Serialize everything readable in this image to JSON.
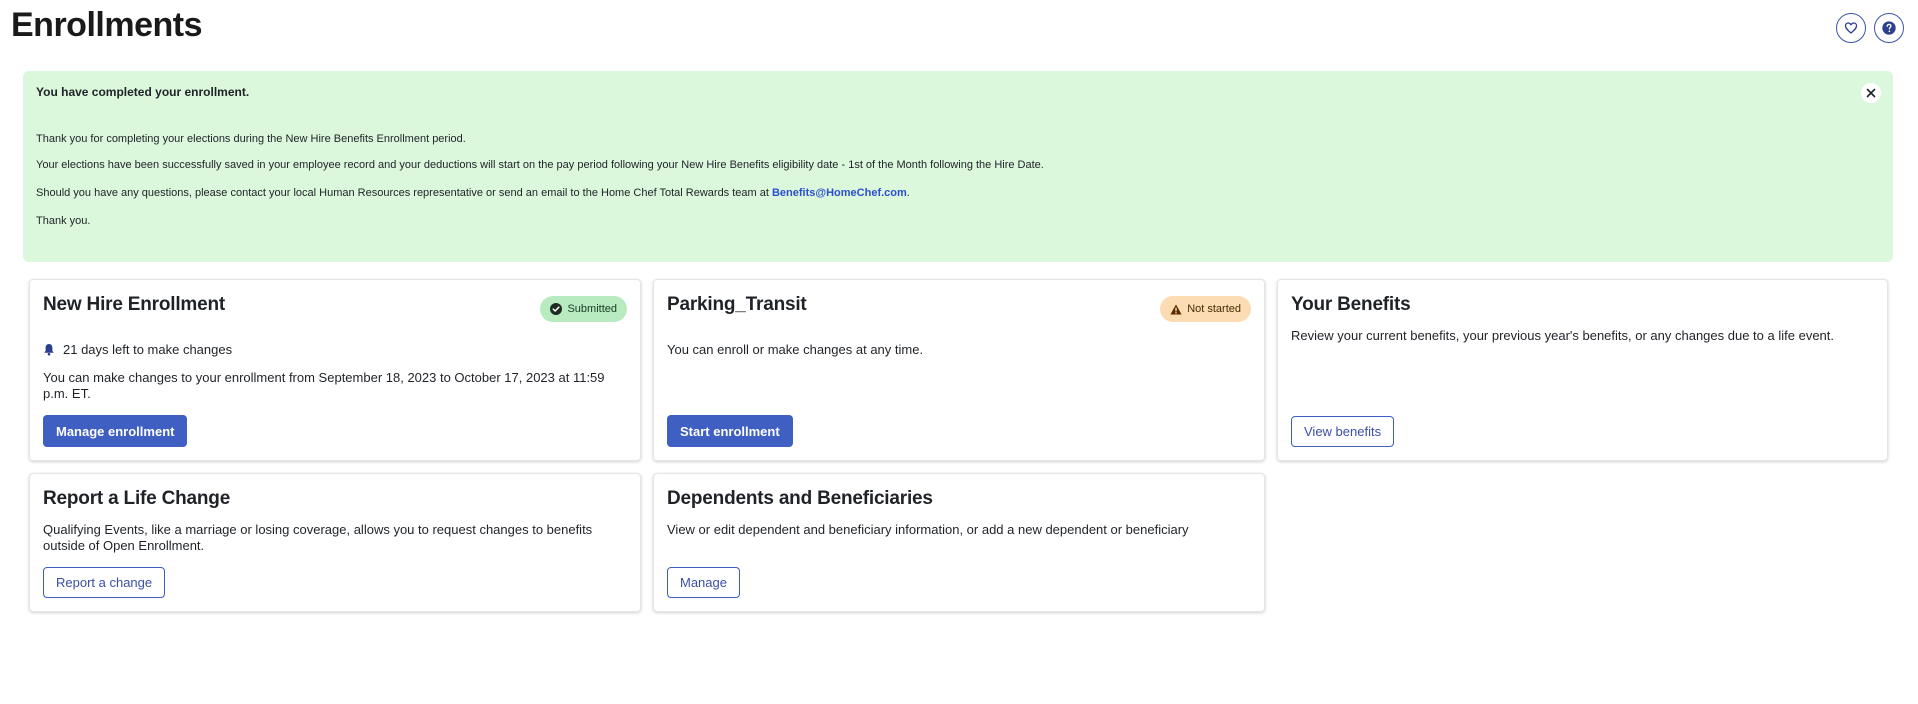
{
  "header": {
    "title": "Enrollments",
    "favorite_icon": "heart-icon",
    "help_icon": "question-icon"
  },
  "banner": {
    "title": "You have completed your enrollment.",
    "line1": "Thank you for completing your elections during the New Hire Benefits Enrollment period.",
    "line2": "Your elections have been successfully saved in your employee record and your deductions will start on the pay period following your New Hire Benefits eligibility date - 1st of the Month following the Hire Date.",
    "line3_prefix": "Should you have any questions, please contact your local Human Resources representative or send an email to the Home Chef Total Rewards team at ",
    "line3_link": "Benefits@HomeChef.com",
    "line3_suffix": ".",
    "line4": "Thank you.",
    "background": "#dbf7dc",
    "close_icon": "close-icon"
  },
  "cards": {
    "new_hire": {
      "title": "New Hire Enrollment",
      "status": "Submitted",
      "status_color": "#b8ecc0",
      "reminder": "21 days left to make changes",
      "description": "You can make changes to your enrollment from September 18, 2023 to October 17, 2023 at 11:59 p.m. ET.",
      "button": "Manage enrollment"
    },
    "parking": {
      "title": "Parking_Transit",
      "status": "Not started",
      "status_color": "#fbdcb3",
      "description": "You can enroll or make changes at any time.",
      "button": "Start enrollment"
    },
    "benefits": {
      "title": "Your Benefits",
      "description": "Review your current benefits, your previous year's benefits, or any changes due to a life event.",
      "button": "View benefits"
    },
    "life_change": {
      "title": "Report a Life Change",
      "description": "Qualifying Events, like a marriage or losing coverage, allows you to request changes to benefits outside of Open Enrollment.",
      "button": "Report a change"
    },
    "dependents": {
      "title": "Dependents and Beneficiaries",
      "description": "View or edit dependent and beneficiary information, or add a new dependent or beneficiary",
      "button": "Manage"
    }
  },
  "colors": {
    "primary": "#3f5fc2",
    "link": "#2b4fd0"
  }
}
